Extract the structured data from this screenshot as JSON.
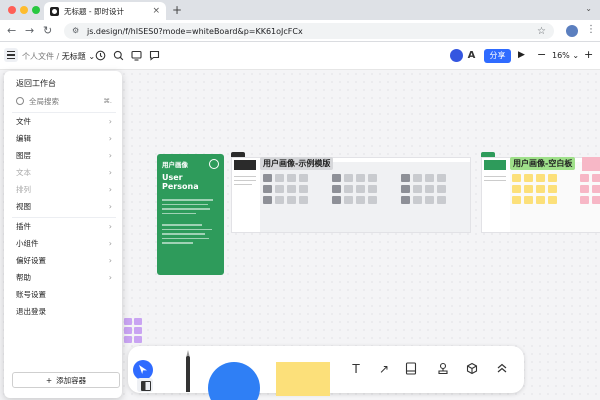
{
  "browser": {
    "tab_title": "无标题 - 即时设计",
    "tab_close": "×",
    "new_tab": "+",
    "url": "js.design/f/hISES0?mode=whiteBoard&p=KK61oJcFCx",
    "back_icon": "←",
    "forward_icon": "→",
    "reload_icon": "↻",
    "star_icon": "☆",
    "more_icon": "⋮",
    "down_icon": "⌄"
  },
  "toolbar": {
    "breadcrumb_folder": "个人文件",
    "breadcrumb_sep": " / ",
    "file_name": "无标题",
    "file_chevron": "⌄",
    "share_label": "分享",
    "zoom_minus": "−",
    "zoom_value": "16%",
    "zoom_chevron": "⌄",
    "zoom_plus": "+",
    "accent": "#2f6bff",
    "user_color": "#3456e0"
  },
  "menu": {
    "back_label": "返回工作台",
    "search_placeholder": "全局搜索",
    "search_shortcut": "⌘.",
    "items": [
      {
        "label": "文件",
        "disabled": false
      },
      {
        "label": "编辑",
        "disabled": false
      },
      {
        "label": "图层",
        "disabled": false
      },
      {
        "label": "文本",
        "disabled": true
      },
      {
        "label": "排列",
        "disabled": true
      },
      {
        "label": "视图",
        "disabled": false
      },
      {
        "label": "插件",
        "disabled": false
      },
      {
        "label": "小组件",
        "disabled": false
      },
      {
        "label": "偏好设置",
        "disabled": false
      },
      {
        "label": "帮助",
        "disabled": false
      },
      {
        "label": "账号设置",
        "disabled": false
      },
      {
        "label": "退出登录",
        "disabled": false
      }
    ],
    "chevron": "›",
    "add_container_label": "添加容器",
    "add_icon": "+"
  },
  "canvas": {
    "persona_title": "用户画像",
    "persona_subtitle": "User Persona",
    "template_example_label": "用户画像-示例模版",
    "template_blank_label": "用户画像-空白板",
    "green": "#2e9b5b",
    "label_gray": "#d6d7da",
    "label_green": "#9fe08a",
    "sticky_yellow": "#fce07a",
    "sticky_pink": "#f7b7c6",
    "sticky_purple": "#c9a4f2"
  },
  "bottom_toolbar": {
    "text_icon": "T",
    "line_icon": "↗",
    "stack_icon": "⊟"
  }
}
